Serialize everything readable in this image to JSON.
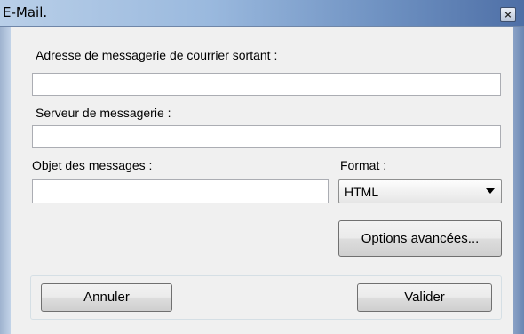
{
  "window": {
    "title": "E-Mail.",
    "close_label": "×"
  },
  "form": {
    "outgoing_address_label": "Adresse de messagerie de courrier sortant :",
    "outgoing_address_value": "",
    "mail_server_label": "Serveur de messagerie :",
    "mail_server_value": "",
    "subject_label": "Objet des messages :",
    "subject_value": "",
    "format_label": "Format :",
    "format_selected": "HTML",
    "advanced_options_label": "Options avancées..."
  },
  "footer": {
    "cancel_label": "Annuler",
    "validate_label": "Valider"
  }
}
